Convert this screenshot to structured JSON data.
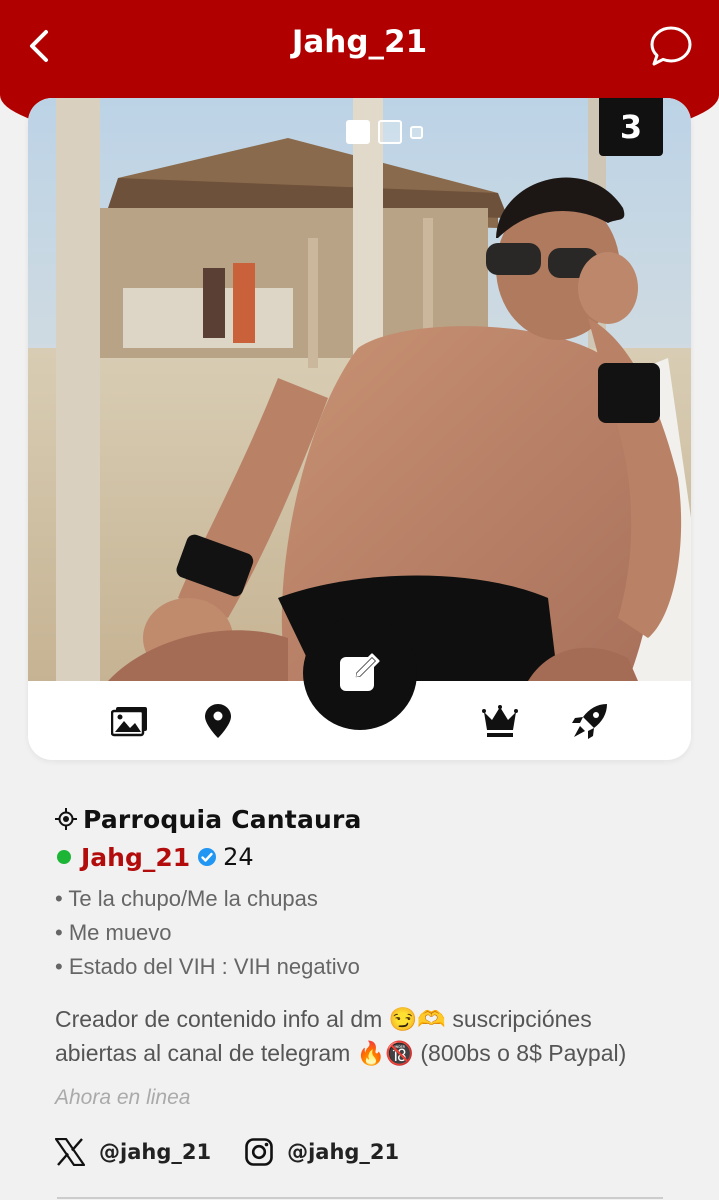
{
  "header": {
    "title": "Jahg_21",
    "back_icon": "chevron-left-icon",
    "chat_icon": "chat-bubble-icon",
    "background_color": "#b10000"
  },
  "photo": {
    "pager": {
      "total": 3,
      "current": 1
    },
    "photo_count": "3"
  },
  "actions": [
    {
      "icon": "gallery-icon"
    },
    {
      "icon": "location-pin-icon"
    },
    {
      "icon": "edit-icon"
    },
    {
      "icon": "crown-icon"
    },
    {
      "icon": "rocket-icon"
    }
  ],
  "profile": {
    "location": "Parroquia Cantaura",
    "username": "Jahg_21",
    "age": "24",
    "online_color": "#1db536",
    "name_color": "#b30c0c",
    "details": [
      "• Te la chupo/Me la chupas",
      "• Me muevo",
      "• Estado del VIH : VIH negativo"
    ],
    "bio": "Creador de contenido info al dm 😏🫶 suscripciónes abiertas al canal de telegram 🔥🔞 (800bs o 8$ Paypal)",
    "status": "Ahora en linea"
  },
  "social": {
    "x_handle": "@jahg_21",
    "instagram_handle": "@jahg_21"
  }
}
